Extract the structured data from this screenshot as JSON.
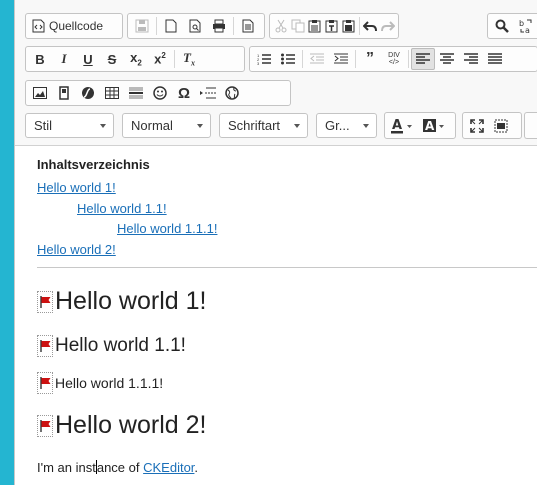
{
  "toolbar": {
    "source_label": "Quellcode",
    "style_combo": "Stil",
    "format_combo": "Normal",
    "font_combo": "Schriftart",
    "size_combo": "Gr..."
  },
  "content": {
    "toc_title": "Inhaltsverzeichnis",
    "toc": [
      {
        "text": "Hello world 1!"
      },
      {
        "text": "Hello world 1.1!"
      },
      {
        "text": "Hello world 1.1.1!"
      },
      {
        "text": "Hello world 2!"
      }
    ],
    "headings": [
      {
        "text": "Hello world 1!"
      },
      {
        "text": "Hello world 1.1!"
      },
      {
        "text": "Hello world 1.1.1!"
      },
      {
        "text": "Hello world 2!"
      }
    ],
    "paragraph_before": "I'm an inst",
    "paragraph_middle": "ance of ",
    "paragraph_link": "CKEditor",
    "paragraph_after": "."
  },
  "colors": {
    "background": "#24b5d1",
    "link": "#1a6fb8",
    "anchor_flag": "#cc1111"
  }
}
